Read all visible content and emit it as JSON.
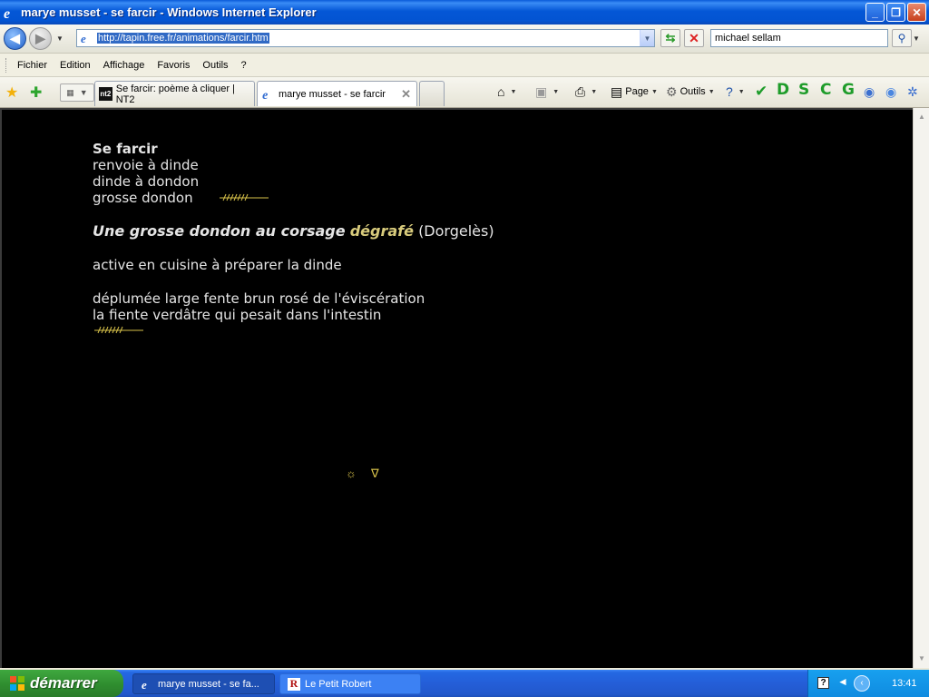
{
  "window": {
    "title": "marye musset - se farcir - Windows Internet Explorer",
    "controls": {
      "minimize": "_",
      "restore": "❐",
      "close": "✕"
    }
  },
  "address_bar": {
    "url": "http://tapin.free.fr/animations/farcir.htm"
  },
  "search": {
    "value": "michael sellam"
  },
  "menu": {
    "items": [
      "Fichier",
      "Edition",
      "Affichage",
      "Favoris",
      "Outils",
      "?"
    ]
  },
  "tabs": [
    {
      "label": "Se farcir: poème à cliquer | NT2",
      "favicon": "nt2",
      "active": false
    },
    {
      "label": "marye musset - se farcir",
      "favicon": "ie-icon",
      "active": true
    }
  ],
  "command_bar": {
    "page_label": "Page",
    "tools_label": "Outils",
    "letters": [
      {
        "text": "D",
        "color": "#1e9c2a"
      },
      {
        "text": "S",
        "color": "#1e9c2a"
      },
      {
        "text": "C",
        "color": "#1e9c2a"
      },
      {
        "text": "G",
        "color": "#1e9c2a"
      }
    ]
  },
  "page": {
    "lines": {
      "title": "Se farcir",
      "l2": "renvoie à dinde",
      "l3": "dinde à dondon",
      "l4": "grosse dondon",
      "quote_italic": "Une grosse dondon au corsage",
      "quote_highlight": "dégrafé",
      "quote_author": "(Dorgelès)",
      "l5": "active en cuisine à préparer la dinde",
      "l6": "déplumée large fente brun rosé de l'éviscération",
      "l7": "la fiente verdâtre qui pesait dans l'intestin"
    },
    "symbols": {
      "sun": "☼",
      "triangle": "∇"
    },
    "accent_color": "#d8c24a"
  },
  "taskbar": {
    "start_label": "démarrer",
    "items": [
      {
        "label": "marye musset - se fa...",
        "active": true
      },
      {
        "label": "Le Petit Robert",
        "active": false
      }
    ],
    "clock": "13:41"
  }
}
